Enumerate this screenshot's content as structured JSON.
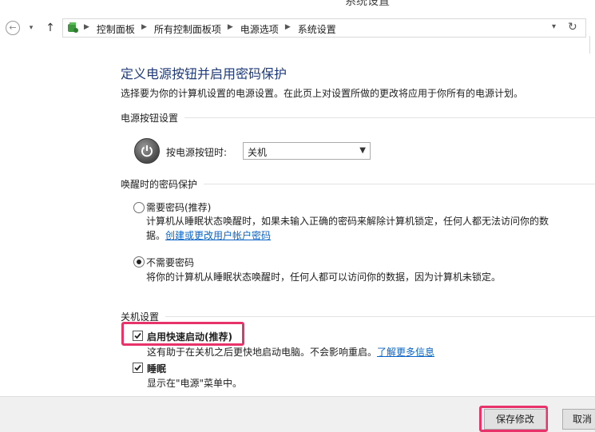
{
  "window": {
    "title": "系统设置"
  },
  "address": {
    "crumbs": [
      "控制面板",
      "所有控制面板项",
      "电源选项",
      "系统设置"
    ]
  },
  "page": {
    "title": "定义电源按钮并启用密码保护",
    "description": "选择要为你的计算机设置的电源设置。在此页上对设置所做的更改将应用于你所有的电源计划。"
  },
  "power_buttons": {
    "section_title": "电源按钮设置",
    "label": "按电源按钮时:",
    "selected": "关机"
  },
  "wake_password": {
    "section_title": "唤醒时的密码保护",
    "require": {
      "label": "需要密码(推荐)",
      "desc_line1": "计算机从睡眠状态唤醒时，如果未输入正确的密码来解除计算机锁定，任何人都无法访问你的数",
      "desc_line2_prefix": "据。",
      "link": "创建或更改用户帐户密码"
    },
    "no_require": {
      "label": "不需要密码",
      "desc": "将你的计算机从睡眠状态唤醒时，任何人都可以访问你的数据，因为计算机未锁定。"
    },
    "selected": "no_require"
  },
  "shutdown": {
    "section_title": "关机设置",
    "fast_startup": {
      "label": "启用快速启动(推荐)",
      "desc": "这有助于在关机之后更快地启动电脑。不会影响重启。",
      "link": "了解更多信息",
      "checked": true
    },
    "sleep": {
      "label": "睡眠",
      "desc": "显示在\"电源\"菜单中。",
      "checked": true
    }
  },
  "footer": {
    "save_label": "保存修改",
    "cancel_label": "取消"
  },
  "colors": {
    "highlight": "#e8336a",
    "title": "#1f3a7a",
    "link": "#0a64c8"
  }
}
